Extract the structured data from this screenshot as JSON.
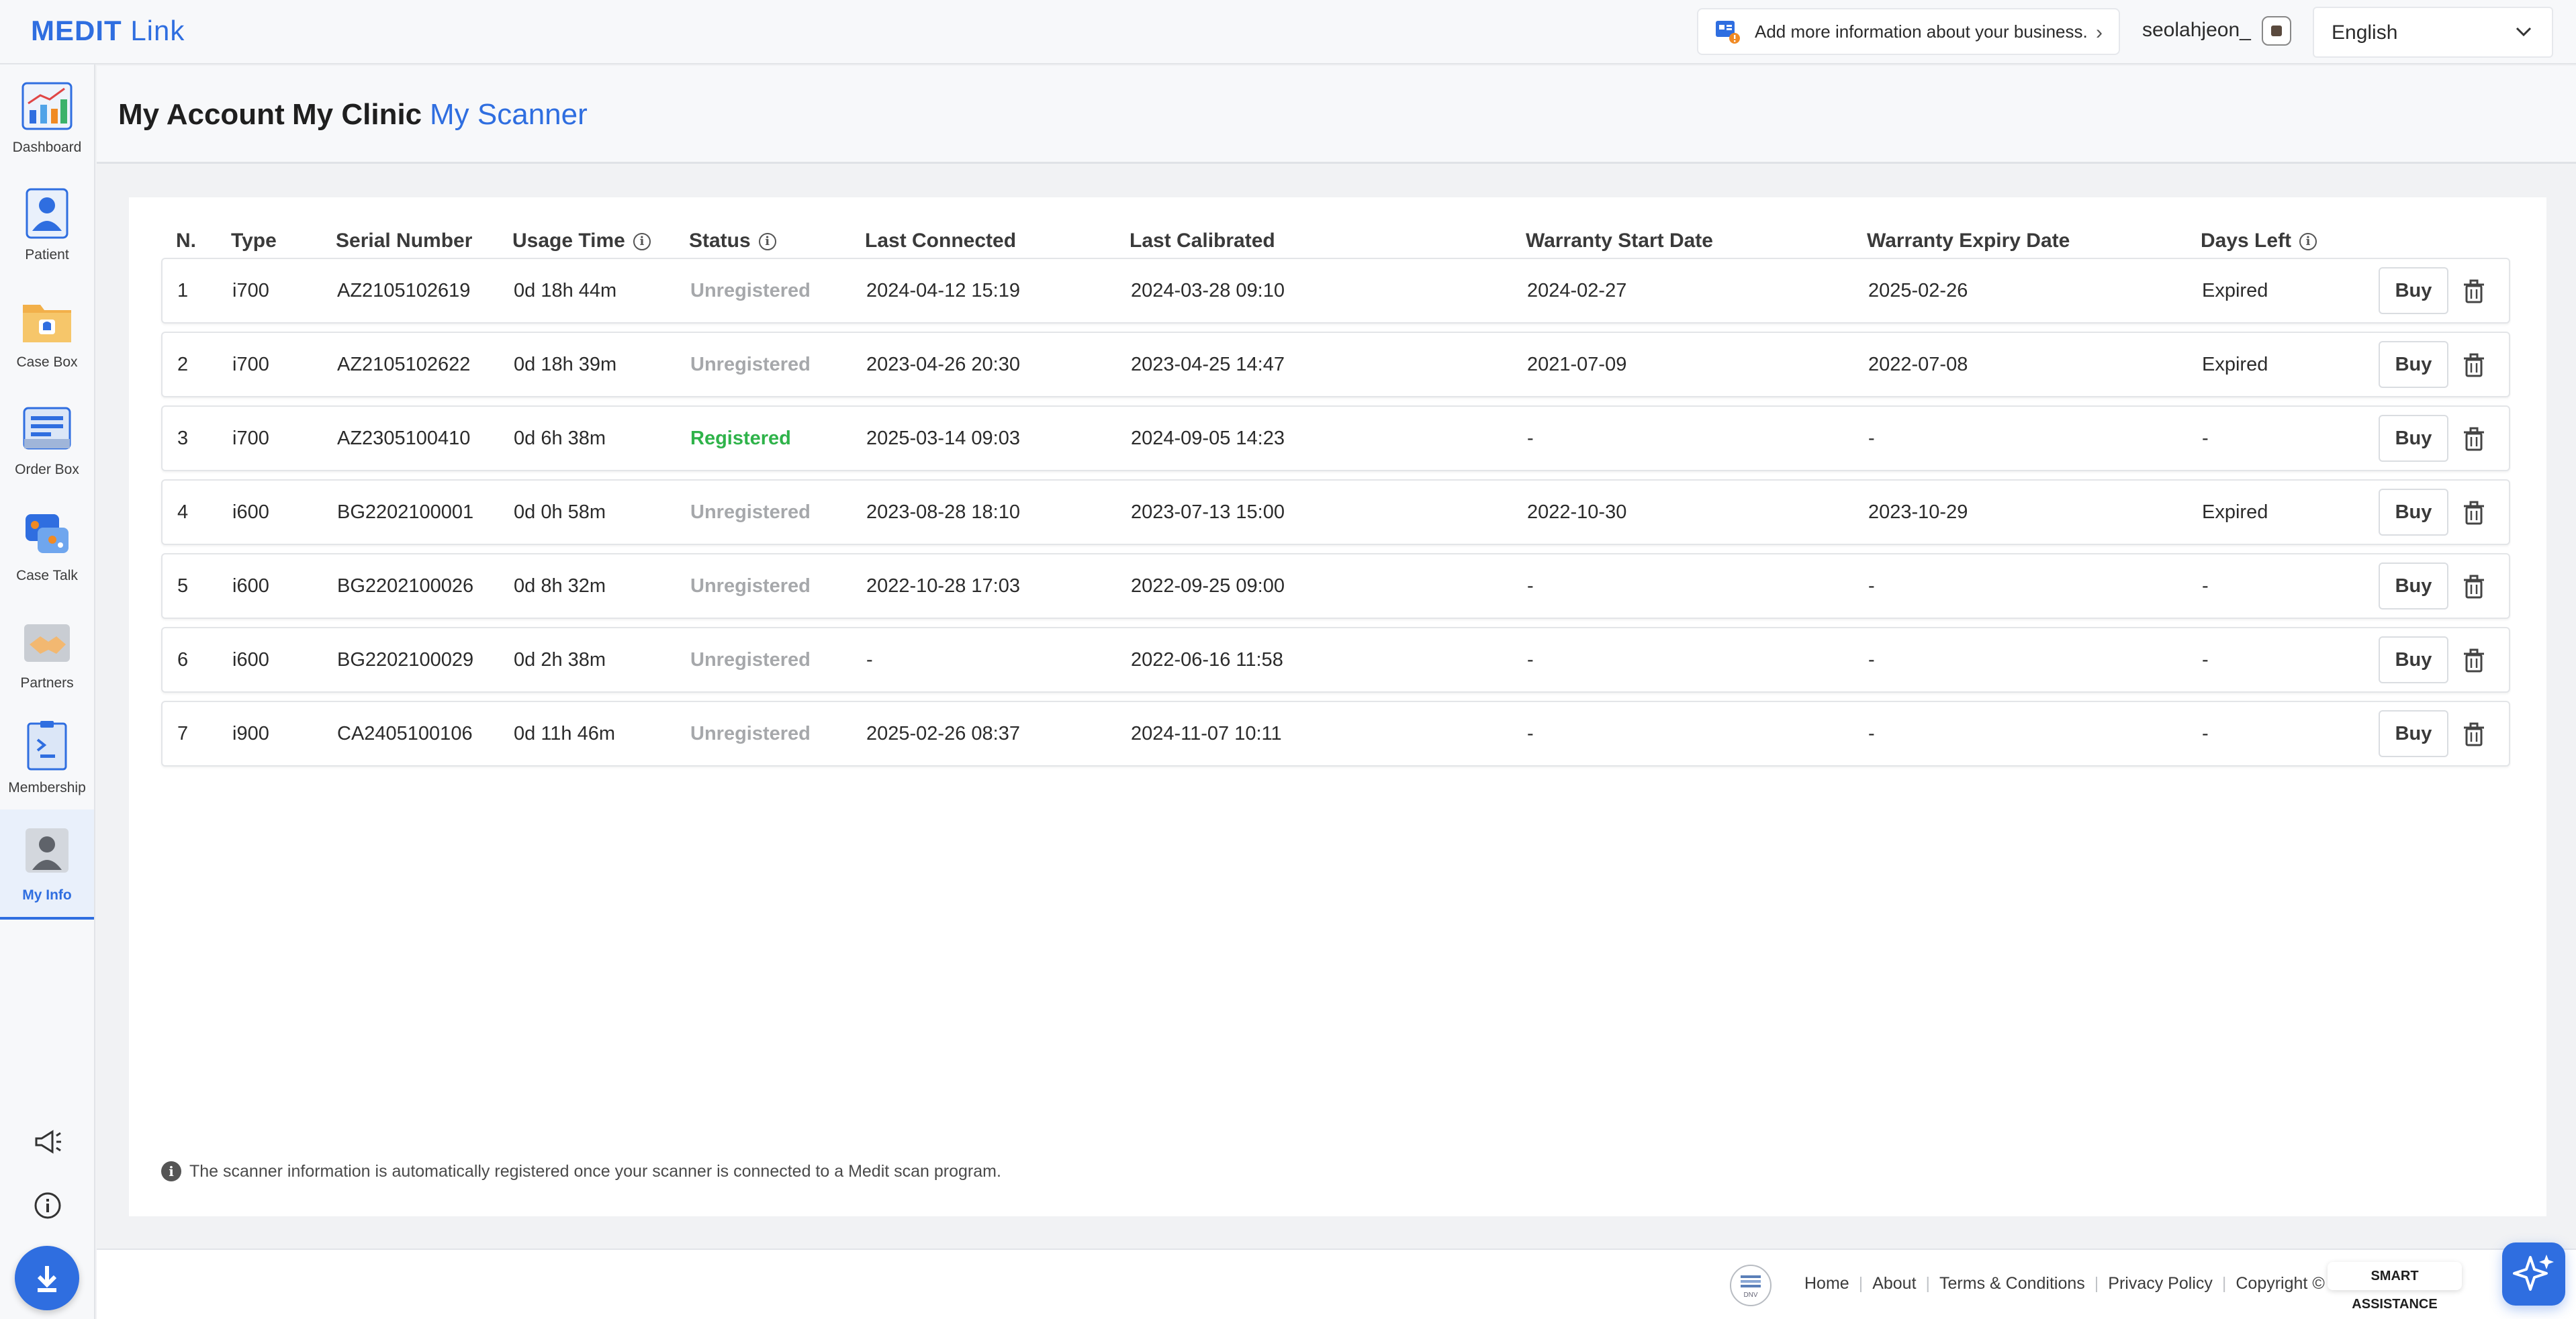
{
  "app": {
    "logo": "MEDIT",
    "logo_sub": "Link"
  },
  "header": {
    "banner_text": "Add more information about your business.",
    "username": "seolahjeon_",
    "language": "English"
  },
  "sidebar": {
    "items": [
      {
        "label": "Dashboard",
        "icon": "dashboard-icon"
      },
      {
        "label": "Patient",
        "icon": "patient-icon"
      },
      {
        "label": "Case Box",
        "icon": "case-box-icon"
      },
      {
        "label": "Order Box",
        "icon": "order-box-icon"
      },
      {
        "label": "Case Talk",
        "icon": "case-talk-icon"
      },
      {
        "label": "Partners",
        "icon": "partners-icon"
      },
      {
        "label": "Membership",
        "icon": "membership-icon"
      },
      {
        "label": "My Info",
        "icon": "my-info-icon",
        "active": true
      }
    ]
  },
  "tabs": [
    {
      "label": "My Account"
    },
    {
      "label": "My Clinic"
    },
    {
      "label": "My Scanner",
      "active": true
    }
  ],
  "table": {
    "headers": {
      "n": "N.",
      "type": "Type",
      "serial": "Serial Number",
      "usage": "Usage Time",
      "status": "Status",
      "last_connected": "Last Connected",
      "last_calibrated": "Last Calibrated",
      "warranty_start": "Warranty Start Date",
      "warranty_expiry": "Warranty Expiry Date",
      "days_left": "Days Left"
    },
    "rows": [
      {
        "n": "1",
        "type": "i700",
        "serial": "AZ2105102619",
        "usage": "0d 18h 44m",
        "status": "Unregistered",
        "last_connected": "2024-04-12 15:19",
        "last_calibrated": "2024-03-28 09:10",
        "warranty_start": "2024-02-27",
        "warranty_expiry": "2025-02-26",
        "days_left": "Expired"
      },
      {
        "n": "2",
        "type": "i700",
        "serial": "AZ2105102622",
        "usage": "0d 18h 39m",
        "status": "Unregistered",
        "last_connected": "2023-04-26 20:30",
        "last_calibrated": "2023-04-25 14:47",
        "warranty_start": "2021-07-09",
        "warranty_expiry": "2022-07-08",
        "days_left": "Expired"
      },
      {
        "n": "3",
        "type": "i700",
        "serial": "AZ2305100410",
        "usage": "0d 6h 38m",
        "status": "Registered",
        "last_connected": "2025-03-14 09:03",
        "last_calibrated": "2024-09-05 14:23",
        "warranty_start": "-",
        "warranty_expiry": "-",
        "days_left": "-"
      },
      {
        "n": "4",
        "type": "i600",
        "serial": "BG2202100001",
        "usage": "0d 0h 58m",
        "status": "Unregistered",
        "last_connected": "2023-08-28 18:10",
        "last_calibrated": "2023-07-13 15:00",
        "warranty_start": "2022-10-30",
        "warranty_expiry": "2023-10-29",
        "days_left": "Expired"
      },
      {
        "n": "5",
        "type": "i600",
        "serial": "BG2202100026",
        "usage": "0d 8h 32m",
        "status": "Unregistered",
        "last_connected": "2022-10-28 17:03",
        "last_calibrated": "2022-09-25 09:00",
        "warranty_start": "-",
        "warranty_expiry": "-",
        "days_left": "-"
      },
      {
        "n": "6",
        "type": "i600",
        "serial": "BG2202100029",
        "usage": "0d 2h 38m",
        "status": "Unregistered",
        "last_connected": "-",
        "last_calibrated": "2022-06-16 11:58",
        "warranty_start": "-",
        "warranty_expiry": "-",
        "days_left": "-"
      },
      {
        "n": "7",
        "type": "i900",
        "serial": "CA2405100106",
        "usage": "0d 11h 46m",
        "status": "Unregistered",
        "last_connected": "2025-02-26 08:37",
        "last_calibrated": "2024-11-07 10:11",
        "warranty_start": "-",
        "warranty_expiry": "-",
        "days_left": "-"
      }
    ],
    "buy_label": "Buy"
  },
  "footnote": "The scanner information is automatically registered once your scanner is connected to a Medit scan program.",
  "footer": {
    "badge": "DNV",
    "links": [
      "Home",
      "About",
      "Terms & Conditions",
      "Privacy Policy"
    ],
    "copyright": "Copyright ©"
  },
  "smart_assistance": "SMART ASSISTANCE",
  "colors": {
    "accent": "#2f6ee0",
    "registered": "#2fb34a",
    "unregistered": "#a6a8ab"
  }
}
